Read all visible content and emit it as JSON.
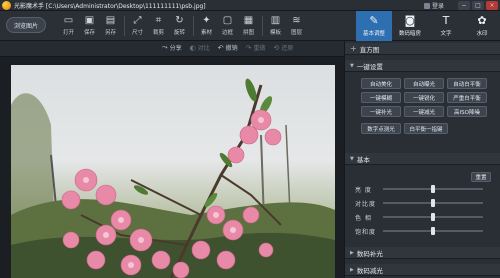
{
  "app": {
    "title": "光影魔术手 [C:\\Users\\Administrator\\Desktop\\111111111\\psb.jpg]",
    "login_label": "登录"
  },
  "window_controls": {
    "minimize": "−",
    "maximize": "□",
    "close": "×"
  },
  "toolbar": {
    "open_label": "浏览图片",
    "tools": [
      {
        "name": "open",
        "label": "打开",
        "icon": "folder-icon",
        "glyph": "▭"
      },
      {
        "name": "save",
        "label": "保存",
        "icon": "save-icon",
        "glyph": "▣"
      },
      {
        "name": "save-as",
        "label": "另存",
        "icon": "save-as-icon",
        "glyph": "▤"
      },
      {
        "name": "size",
        "label": "尺寸",
        "icon": "resize-icon",
        "glyph": "⤢"
      },
      {
        "name": "crop",
        "label": "裁剪",
        "icon": "crop-icon",
        "glyph": "⌗"
      },
      {
        "name": "rotate",
        "label": "旋转",
        "icon": "rotate-icon",
        "glyph": "↻"
      },
      {
        "name": "material",
        "label": "素材",
        "icon": "material-icon",
        "glyph": "✦"
      },
      {
        "name": "border",
        "label": "边框",
        "icon": "border-icon",
        "glyph": "▢"
      },
      {
        "name": "collage",
        "label": "拼图",
        "icon": "collage-icon",
        "glyph": "▦"
      },
      {
        "name": "template",
        "label": "模板",
        "icon": "template-icon",
        "glyph": "▥"
      },
      {
        "name": "more",
        "label": "图层",
        "icon": "layers-icon",
        "glyph": "≋"
      }
    ]
  },
  "modes": [
    {
      "name": "basic-adjust",
      "label": "基本调整",
      "icon": "adjust-icon",
      "glyph": "✎",
      "active": true
    },
    {
      "name": "digital-darkroom",
      "label": "数码暗房",
      "icon": "camera-icon",
      "glyph": "◙",
      "active": false
    },
    {
      "name": "text",
      "label": "文字",
      "icon": "text-icon",
      "glyph": "T",
      "active": false
    },
    {
      "name": "watermark",
      "label": "水印",
      "icon": "watermark-icon",
      "glyph": "✿",
      "active": false
    }
  ],
  "actions": [
    {
      "name": "share",
      "label": "分享",
      "icon": "share-icon",
      "glyph": "⤳",
      "dim": false
    },
    {
      "name": "compare",
      "label": "对比",
      "icon": "compare-icon",
      "glyph": "◐",
      "dim": true
    },
    {
      "name": "undo",
      "label": "撤销",
      "icon": "undo-icon",
      "glyph": "↶",
      "dim": false
    },
    {
      "name": "redo",
      "label": "重做",
      "icon": "redo-icon",
      "glyph": "↷",
      "dim": true
    },
    {
      "name": "restore",
      "label": "还原",
      "icon": "restore-icon",
      "glyph": "⟲",
      "dim": true
    }
  ],
  "panel": {
    "histogram_label": "直方图",
    "one_click_label": "一键设置",
    "one_click_buttons": [
      "自动美化",
      "自动曝光",
      "自动白平衡",
      "一键模糊",
      "一键锐化",
      "严重白平衡",
      "一键补光",
      "一键减光",
      "高ISO降噪"
    ],
    "extra_buttons": [
      "数字点测光",
      "白平衡一指键"
    ],
    "basic_label": "基本",
    "reset_label": "重置",
    "sliders": [
      {
        "label": "亮 度",
        "value": 0.5
      },
      {
        "label": "对比度",
        "value": 0.5
      },
      {
        "label": "色 相",
        "value": 0.5
      },
      {
        "label": "饱和度",
        "value": 0.5
      }
    ],
    "fill_light_label": "数码补光",
    "reduce_light_label": "数码减光"
  }
}
